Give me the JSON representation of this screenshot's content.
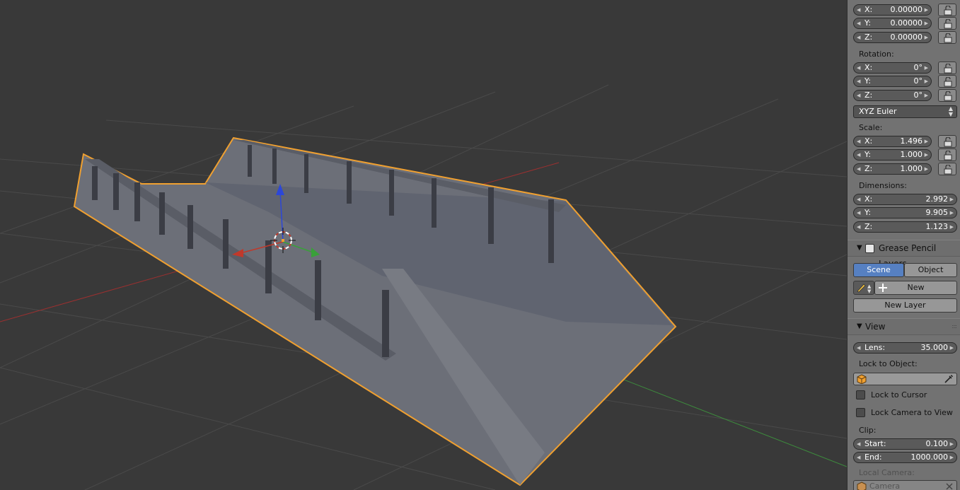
{
  "location": {
    "x": {
      "label": "X:",
      "value": "0.00000"
    },
    "y": {
      "label": "Y:",
      "value": "0.00000"
    },
    "z": {
      "label": "Z:",
      "value": "0.00000"
    }
  },
  "rotation": {
    "label": "Rotation:",
    "x": {
      "label": "X:",
      "value": "0°"
    },
    "y": {
      "label": "Y:",
      "value": "0°"
    },
    "z": {
      "label": "Z:",
      "value": "0°"
    },
    "mode": "XYZ Euler"
  },
  "scale": {
    "label": "Scale:",
    "x": {
      "label": "X:",
      "value": "1.496"
    },
    "y": {
      "label": "Y:",
      "value": "1.000"
    },
    "z": {
      "label": "Z:",
      "value": "1.000"
    }
  },
  "dimensions": {
    "label": "Dimensions:",
    "x": {
      "label": "X:",
      "value": "2.992"
    },
    "y": {
      "label": "Y:",
      "value": "9.905"
    },
    "z": {
      "label": "Z:",
      "value": "1.123"
    }
  },
  "grease_pencil": {
    "title": "Grease Pencil Layers",
    "scene_tab": "Scene",
    "object_tab": "Object",
    "new_label": "New",
    "new_layer_label": "New Layer"
  },
  "view": {
    "title": "View",
    "lens": {
      "label": "Lens:",
      "value": "35.000"
    },
    "lock_to_object_label": "Lock to Object:",
    "lock_to_cursor_label": "Lock to Cursor",
    "lock_camera_label": "Lock Camera to View",
    "clip_label": "Clip:",
    "clip_start": {
      "label": "Start:",
      "value": "0.100"
    },
    "clip_end": {
      "label": "End:",
      "value": "1000.000"
    },
    "local_camera_label": "Local Camera:",
    "local_camera_value": "Camera"
  },
  "colors": {
    "selection_outline": "#f0a030",
    "x_axis": "#c0392b",
    "y_axis": "#3aa03a",
    "z_axis": "#2c47d8",
    "active_tab": "#5680c2"
  },
  "icons": [
    "lock-icon",
    "pencil-icon",
    "plus-icon",
    "object-cube-icon",
    "eyedropper-icon",
    "camera-cube-icon",
    "close-icon",
    "checkbox-icon",
    "3d-cursor-icon",
    "transform-manipulator-icon"
  ]
}
